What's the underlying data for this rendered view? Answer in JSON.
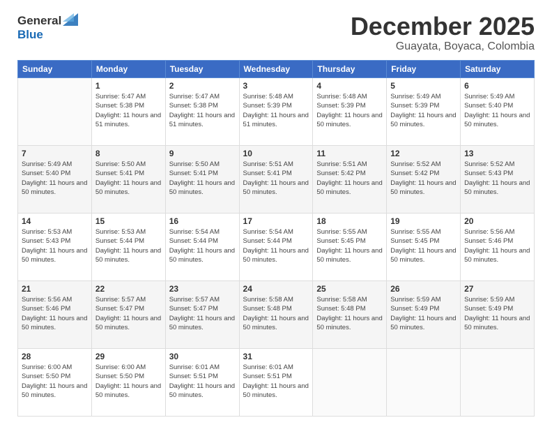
{
  "header": {
    "logo": {
      "line1": "General",
      "line2": "Blue"
    },
    "title": "December 2025",
    "subtitle": "Guayata, Boyaca, Colombia"
  },
  "weekdays": [
    "Sunday",
    "Monday",
    "Tuesday",
    "Wednesday",
    "Thursday",
    "Friday",
    "Saturday"
  ],
  "weeks": [
    [
      {
        "day": "",
        "sunrise": "",
        "sunset": "",
        "daylight": ""
      },
      {
        "day": "1",
        "sunrise": "Sunrise: 5:47 AM",
        "sunset": "Sunset: 5:38 PM",
        "daylight": "Daylight: 11 hours and 51 minutes."
      },
      {
        "day": "2",
        "sunrise": "Sunrise: 5:47 AM",
        "sunset": "Sunset: 5:38 PM",
        "daylight": "Daylight: 11 hours and 51 minutes."
      },
      {
        "day": "3",
        "sunrise": "Sunrise: 5:48 AM",
        "sunset": "Sunset: 5:39 PM",
        "daylight": "Daylight: 11 hours and 51 minutes."
      },
      {
        "day": "4",
        "sunrise": "Sunrise: 5:48 AM",
        "sunset": "Sunset: 5:39 PM",
        "daylight": "Daylight: 11 hours and 50 minutes."
      },
      {
        "day": "5",
        "sunrise": "Sunrise: 5:49 AM",
        "sunset": "Sunset: 5:39 PM",
        "daylight": "Daylight: 11 hours and 50 minutes."
      },
      {
        "day": "6",
        "sunrise": "Sunrise: 5:49 AM",
        "sunset": "Sunset: 5:40 PM",
        "daylight": "Daylight: 11 hours and 50 minutes."
      }
    ],
    [
      {
        "day": "7",
        "sunrise": "Sunrise: 5:49 AM",
        "sunset": "Sunset: 5:40 PM",
        "daylight": "Daylight: 11 hours and 50 minutes."
      },
      {
        "day": "8",
        "sunrise": "Sunrise: 5:50 AM",
        "sunset": "Sunset: 5:41 PM",
        "daylight": "Daylight: 11 hours and 50 minutes."
      },
      {
        "day": "9",
        "sunrise": "Sunrise: 5:50 AM",
        "sunset": "Sunset: 5:41 PM",
        "daylight": "Daylight: 11 hours and 50 minutes."
      },
      {
        "day": "10",
        "sunrise": "Sunrise: 5:51 AM",
        "sunset": "Sunset: 5:41 PM",
        "daylight": "Daylight: 11 hours and 50 minutes."
      },
      {
        "day": "11",
        "sunrise": "Sunrise: 5:51 AM",
        "sunset": "Sunset: 5:42 PM",
        "daylight": "Daylight: 11 hours and 50 minutes."
      },
      {
        "day": "12",
        "sunrise": "Sunrise: 5:52 AM",
        "sunset": "Sunset: 5:42 PM",
        "daylight": "Daylight: 11 hours and 50 minutes."
      },
      {
        "day": "13",
        "sunrise": "Sunrise: 5:52 AM",
        "sunset": "Sunset: 5:43 PM",
        "daylight": "Daylight: 11 hours and 50 minutes."
      }
    ],
    [
      {
        "day": "14",
        "sunrise": "Sunrise: 5:53 AM",
        "sunset": "Sunset: 5:43 PM",
        "daylight": "Daylight: 11 hours and 50 minutes."
      },
      {
        "day": "15",
        "sunrise": "Sunrise: 5:53 AM",
        "sunset": "Sunset: 5:44 PM",
        "daylight": "Daylight: 11 hours and 50 minutes."
      },
      {
        "day": "16",
        "sunrise": "Sunrise: 5:54 AM",
        "sunset": "Sunset: 5:44 PM",
        "daylight": "Daylight: 11 hours and 50 minutes."
      },
      {
        "day": "17",
        "sunrise": "Sunrise: 5:54 AM",
        "sunset": "Sunset: 5:44 PM",
        "daylight": "Daylight: 11 hours and 50 minutes."
      },
      {
        "day": "18",
        "sunrise": "Sunrise: 5:55 AM",
        "sunset": "Sunset: 5:45 PM",
        "daylight": "Daylight: 11 hours and 50 minutes."
      },
      {
        "day": "19",
        "sunrise": "Sunrise: 5:55 AM",
        "sunset": "Sunset: 5:45 PM",
        "daylight": "Daylight: 11 hours and 50 minutes."
      },
      {
        "day": "20",
        "sunrise": "Sunrise: 5:56 AM",
        "sunset": "Sunset: 5:46 PM",
        "daylight": "Daylight: 11 hours and 50 minutes."
      }
    ],
    [
      {
        "day": "21",
        "sunrise": "Sunrise: 5:56 AM",
        "sunset": "Sunset: 5:46 PM",
        "daylight": "Daylight: 11 hours and 50 minutes."
      },
      {
        "day": "22",
        "sunrise": "Sunrise: 5:57 AM",
        "sunset": "Sunset: 5:47 PM",
        "daylight": "Daylight: 11 hours and 50 minutes."
      },
      {
        "day": "23",
        "sunrise": "Sunrise: 5:57 AM",
        "sunset": "Sunset: 5:47 PM",
        "daylight": "Daylight: 11 hours and 50 minutes."
      },
      {
        "day": "24",
        "sunrise": "Sunrise: 5:58 AM",
        "sunset": "Sunset: 5:48 PM",
        "daylight": "Daylight: 11 hours and 50 minutes."
      },
      {
        "day": "25",
        "sunrise": "Sunrise: 5:58 AM",
        "sunset": "Sunset: 5:48 PM",
        "daylight": "Daylight: 11 hours and 50 minutes."
      },
      {
        "day": "26",
        "sunrise": "Sunrise: 5:59 AM",
        "sunset": "Sunset: 5:49 PM",
        "daylight": "Daylight: 11 hours and 50 minutes."
      },
      {
        "day": "27",
        "sunrise": "Sunrise: 5:59 AM",
        "sunset": "Sunset: 5:49 PM",
        "daylight": "Daylight: 11 hours and 50 minutes."
      }
    ],
    [
      {
        "day": "28",
        "sunrise": "Sunrise: 6:00 AM",
        "sunset": "Sunset: 5:50 PM",
        "daylight": "Daylight: 11 hours and 50 minutes."
      },
      {
        "day": "29",
        "sunrise": "Sunrise: 6:00 AM",
        "sunset": "Sunset: 5:50 PM",
        "daylight": "Daylight: 11 hours and 50 minutes."
      },
      {
        "day": "30",
        "sunrise": "Sunrise: 6:01 AM",
        "sunset": "Sunset: 5:51 PM",
        "daylight": "Daylight: 11 hours and 50 minutes."
      },
      {
        "day": "31",
        "sunrise": "Sunrise: 6:01 AM",
        "sunset": "Sunset: 5:51 PM",
        "daylight": "Daylight: 11 hours and 50 minutes."
      },
      {
        "day": "",
        "sunrise": "",
        "sunset": "",
        "daylight": ""
      },
      {
        "day": "",
        "sunrise": "",
        "sunset": "",
        "daylight": ""
      },
      {
        "day": "",
        "sunrise": "",
        "sunset": "",
        "daylight": ""
      }
    ]
  ]
}
